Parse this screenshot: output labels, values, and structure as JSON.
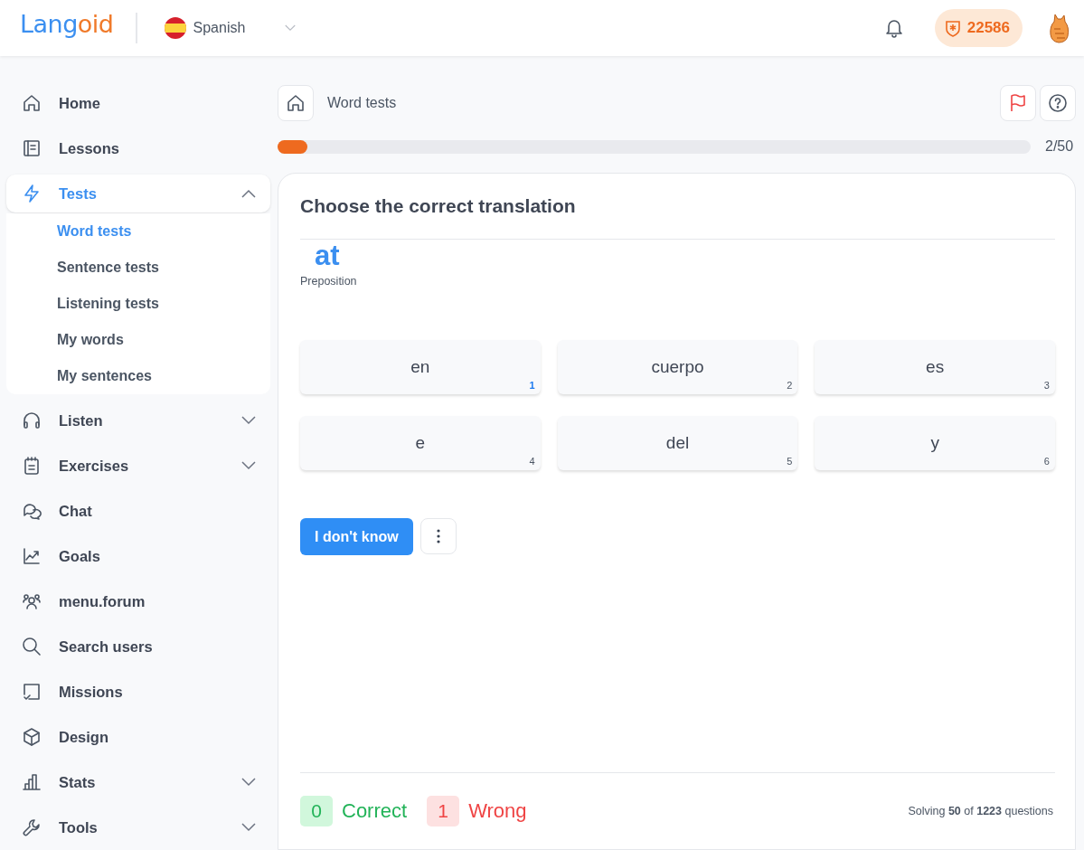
{
  "header": {
    "logo": [
      "Lang",
      "oid"
    ],
    "language": "Spanish",
    "points": "22586"
  },
  "sidebar": {
    "items": [
      {
        "label": "Home",
        "kind": "link",
        "selected": false
      },
      {
        "label": "Lessons",
        "kind": "link",
        "selected": false
      },
      {
        "label": "Tests",
        "kind": "group",
        "selected": true,
        "expanded": true,
        "children": [
          {
            "label": "Word tests",
            "selected": true
          },
          {
            "label": "Sentence tests",
            "selected": false
          },
          {
            "label": "Listening tests",
            "selected": false
          },
          {
            "label": "My words",
            "selected": false
          },
          {
            "label": "My sentences",
            "selected": false
          }
        ]
      },
      {
        "label": "Listen",
        "kind": "group",
        "selected": false,
        "expanded": false
      },
      {
        "label": "Exercises",
        "kind": "group",
        "selected": false,
        "expanded": false
      },
      {
        "label": "Chat",
        "kind": "link",
        "selected": false
      },
      {
        "label": "Goals",
        "kind": "link",
        "selected": false
      },
      {
        "label": "menu.forum",
        "kind": "link",
        "selected": false
      },
      {
        "label": "Search users",
        "kind": "link",
        "selected": false
      },
      {
        "label": "Missions",
        "kind": "link",
        "selected": false
      },
      {
        "label": "Design",
        "kind": "link",
        "selected": false
      },
      {
        "label": "Stats",
        "kind": "group",
        "selected": false,
        "expanded": false
      },
      {
        "label": "Tools",
        "kind": "group",
        "selected": false,
        "expanded": false
      }
    ]
  },
  "breadcrumb": "Word tests",
  "progress": {
    "level": 0.04,
    "reading": "2/50"
  },
  "question": {
    "title": "Choose the correct translation",
    "word": "at",
    "part_of_speech": "Preposition",
    "options": [
      {
        "label": "en",
        "key": "1",
        "selected": true
      },
      {
        "label": "cuerpo",
        "key": "2",
        "selected": false
      },
      {
        "label": "es",
        "key": "3",
        "selected": false
      },
      {
        "label": "e",
        "key": "4",
        "selected": false
      },
      {
        "label": "del",
        "key": "5",
        "selected": false
      },
      {
        "label": "y",
        "key": "6",
        "selected": false
      }
    ],
    "dont_know_button": "I don't know"
  },
  "footer": {
    "correct_count": "0",
    "correct_label": "Correct",
    "wrong_count": "1",
    "wrong_label": "Wrong",
    "summary": "Solving **50** of **1223** questions"
  }
}
